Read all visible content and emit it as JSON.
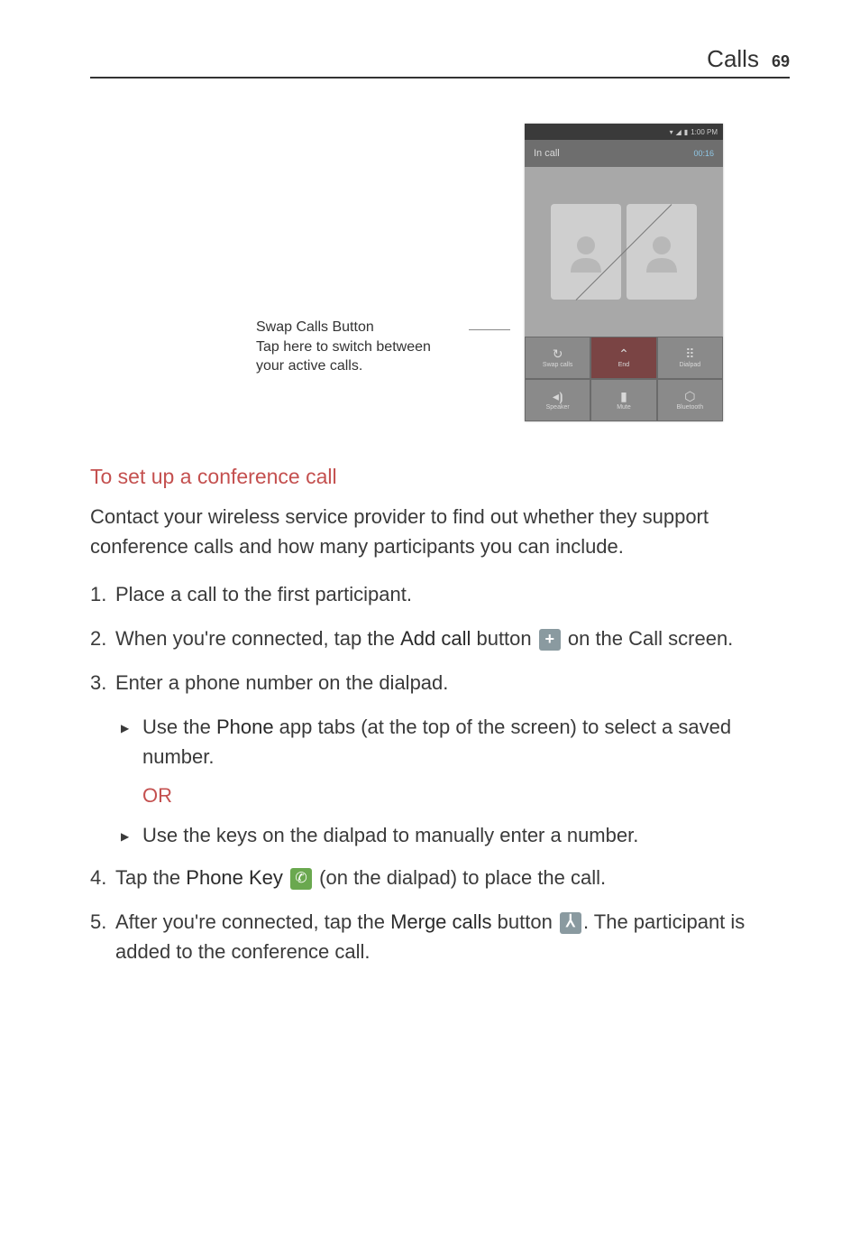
{
  "header": {
    "section": "Calls",
    "page_num": "69"
  },
  "callout": {
    "title": "Swap Calls Button",
    "desc": "Tap here to switch between your active calls."
  },
  "phone": {
    "status_time": "1:00 PM",
    "in_call_label": "In call",
    "timer": "00:16",
    "buttons_row1": {
      "swap": "Swap calls",
      "end": "End",
      "dialpad": "Dialpad"
    },
    "buttons_row2": {
      "speaker": "Speaker",
      "mute": "Mute",
      "bluetooth": "Bluetooth"
    }
  },
  "section_heading": "To set up a conference call",
  "intro_text": "Contact your wireless service provider to find out whether they support conference calls and how many participants you can include.",
  "steps": {
    "s1": "Place a call to the first participant.",
    "s2_a": "When you're connected, tap the ",
    "s2_bold": "Add call",
    "s2_b": " button ",
    "s2_c": " on the Call screen.",
    "s3": "Enter a phone number on the dialpad.",
    "s3_bullet1_a": "Use the ",
    "s3_bullet1_bold": "Phone",
    "s3_bullet1_b": " app tabs (at the top of the screen) to select a saved number.",
    "or": "OR",
    "s3_bullet2": "Use the keys on the dialpad to manually enter a number.",
    "s4_a": "Tap the ",
    "s4_bold": "Phone Key",
    "s4_b": " ",
    "s4_c": " (on the dialpad) to place the call.",
    "s5_a": "After you're connected, tap the ",
    "s5_bold": "Merge calls",
    "s5_b": " button ",
    "s5_c": ". The participant is added to the conference call."
  }
}
